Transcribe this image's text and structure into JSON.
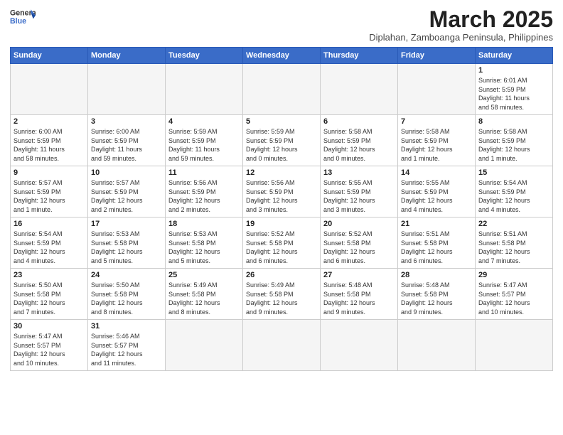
{
  "header": {
    "logo_general": "General",
    "logo_blue": "Blue",
    "month_year": "March 2025",
    "subtitle": "Diplahan, Zamboanga Peninsula, Philippines"
  },
  "weekdays": [
    "Sunday",
    "Monday",
    "Tuesday",
    "Wednesday",
    "Thursday",
    "Friday",
    "Saturday"
  ],
  "weeks": [
    [
      {
        "day": "",
        "info": ""
      },
      {
        "day": "",
        "info": ""
      },
      {
        "day": "",
        "info": ""
      },
      {
        "day": "",
        "info": ""
      },
      {
        "day": "",
        "info": ""
      },
      {
        "day": "",
        "info": ""
      },
      {
        "day": "1",
        "info": "Sunrise: 6:01 AM\nSunset: 5:59 PM\nDaylight: 11 hours\nand 58 minutes."
      }
    ],
    [
      {
        "day": "2",
        "info": "Sunrise: 6:00 AM\nSunset: 5:59 PM\nDaylight: 11 hours\nand 58 minutes."
      },
      {
        "day": "3",
        "info": "Sunrise: 6:00 AM\nSunset: 5:59 PM\nDaylight: 11 hours\nand 59 minutes."
      },
      {
        "day": "4",
        "info": "Sunrise: 5:59 AM\nSunset: 5:59 PM\nDaylight: 11 hours\nand 59 minutes."
      },
      {
        "day": "5",
        "info": "Sunrise: 5:59 AM\nSunset: 5:59 PM\nDaylight: 12 hours\nand 0 minutes."
      },
      {
        "day": "6",
        "info": "Sunrise: 5:58 AM\nSunset: 5:59 PM\nDaylight: 12 hours\nand 0 minutes."
      },
      {
        "day": "7",
        "info": "Sunrise: 5:58 AM\nSunset: 5:59 PM\nDaylight: 12 hours\nand 1 minute."
      },
      {
        "day": "8",
        "info": "Sunrise: 5:58 AM\nSunset: 5:59 PM\nDaylight: 12 hours\nand 1 minute."
      }
    ],
    [
      {
        "day": "9",
        "info": "Sunrise: 5:57 AM\nSunset: 5:59 PM\nDaylight: 12 hours\nand 1 minute."
      },
      {
        "day": "10",
        "info": "Sunrise: 5:57 AM\nSunset: 5:59 PM\nDaylight: 12 hours\nand 2 minutes."
      },
      {
        "day": "11",
        "info": "Sunrise: 5:56 AM\nSunset: 5:59 PM\nDaylight: 12 hours\nand 2 minutes."
      },
      {
        "day": "12",
        "info": "Sunrise: 5:56 AM\nSunset: 5:59 PM\nDaylight: 12 hours\nand 3 minutes."
      },
      {
        "day": "13",
        "info": "Sunrise: 5:55 AM\nSunset: 5:59 PM\nDaylight: 12 hours\nand 3 minutes."
      },
      {
        "day": "14",
        "info": "Sunrise: 5:55 AM\nSunset: 5:59 PM\nDaylight: 12 hours\nand 4 minutes."
      },
      {
        "day": "15",
        "info": "Sunrise: 5:54 AM\nSunset: 5:59 PM\nDaylight: 12 hours\nand 4 minutes."
      }
    ],
    [
      {
        "day": "16",
        "info": "Sunrise: 5:54 AM\nSunset: 5:59 PM\nDaylight: 12 hours\nand 4 minutes."
      },
      {
        "day": "17",
        "info": "Sunrise: 5:53 AM\nSunset: 5:58 PM\nDaylight: 12 hours\nand 5 minutes."
      },
      {
        "day": "18",
        "info": "Sunrise: 5:53 AM\nSunset: 5:58 PM\nDaylight: 12 hours\nand 5 minutes."
      },
      {
        "day": "19",
        "info": "Sunrise: 5:52 AM\nSunset: 5:58 PM\nDaylight: 12 hours\nand 6 minutes."
      },
      {
        "day": "20",
        "info": "Sunrise: 5:52 AM\nSunset: 5:58 PM\nDaylight: 12 hours\nand 6 minutes."
      },
      {
        "day": "21",
        "info": "Sunrise: 5:51 AM\nSunset: 5:58 PM\nDaylight: 12 hours\nand 6 minutes."
      },
      {
        "day": "22",
        "info": "Sunrise: 5:51 AM\nSunset: 5:58 PM\nDaylight: 12 hours\nand 7 minutes."
      }
    ],
    [
      {
        "day": "23",
        "info": "Sunrise: 5:50 AM\nSunset: 5:58 PM\nDaylight: 12 hours\nand 7 minutes."
      },
      {
        "day": "24",
        "info": "Sunrise: 5:50 AM\nSunset: 5:58 PM\nDaylight: 12 hours\nand 8 minutes."
      },
      {
        "day": "25",
        "info": "Sunrise: 5:49 AM\nSunset: 5:58 PM\nDaylight: 12 hours\nand 8 minutes."
      },
      {
        "day": "26",
        "info": "Sunrise: 5:49 AM\nSunset: 5:58 PM\nDaylight: 12 hours\nand 9 minutes."
      },
      {
        "day": "27",
        "info": "Sunrise: 5:48 AM\nSunset: 5:58 PM\nDaylight: 12 hours\nand 9 minutes."
      },
      {
        "day": "28",
        "info": "Sunrise: 5:48 AM\nSunset: 5:58 PM\nDaylight: 12 hours\nand 9 minutes."
      },
      {
        "day": "29",
        "info": "Sunrise: 5:47 AM\nSunset: 5:57 PM\nDaylight: 12 hours\nand 10 minutes."
      }
    ],
    [
      {
        "day": "30",
        "info": "Sunrise: 5:47 AM\nSunset: 5:57 PM\nDaylight: 12 hours\nand 10 minutes."
      },
      {
        "day": "31",
        "info": "Sunrise: 5:46 AM\nSunset: 5:57 PM\nDaylight: 12 hours\nand 11 minutes."
      },
      {
        "day": "",
        "info": ""
      },
      {
        "day": "",
        "info": ""
      },
      {
        "day": "",
        "info": ""
      },
      {
        "day": "",
        "info": ""
      },
      {
        "day": "",
        "info": ""
      }
    ]
  ]
}
